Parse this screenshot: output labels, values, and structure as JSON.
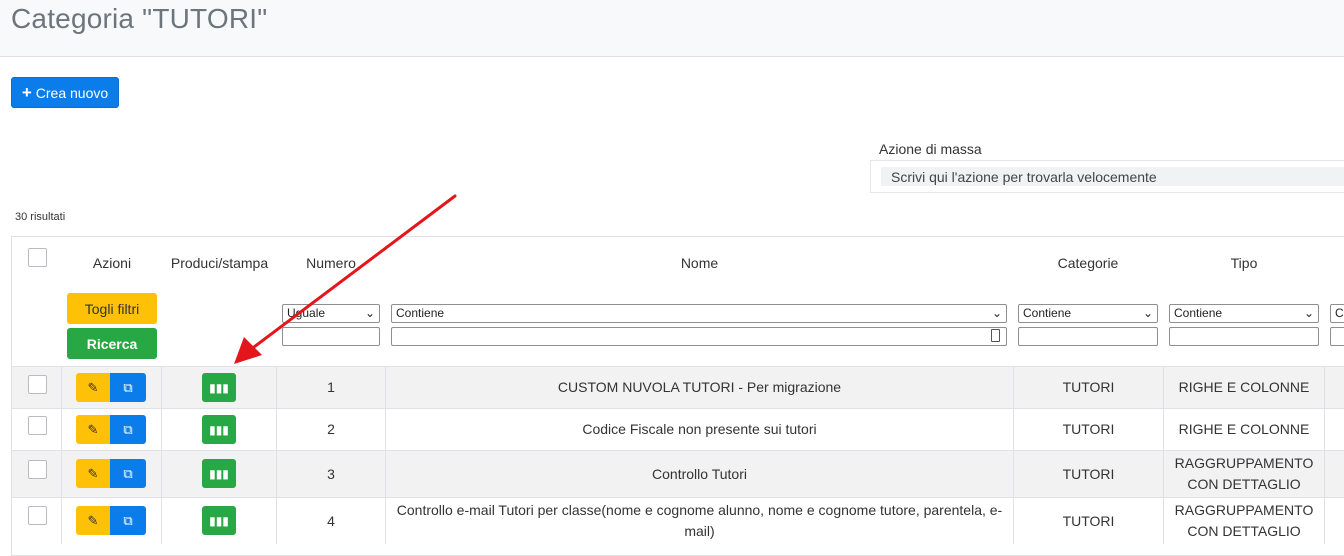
{
  "page": {
    "title": "Categoria \"TUTORI\""
  },
  "toolbar": {
    "create_label": "Crea nuovo"
  },
  "mass_action": {
    "label": "Azione di massa",
    "placeholder": "Scrivi qui l'azione per trovarla velocemente"
  },
  "results": {
    "count_text": "30 risultati"
  },
  "table": {
    "headers": {
      "actions": "Azioni",
      "print": "Produci/stampa",
      "number": "Numero",
      "name": "Nome",
      "categories": "Categorie",
      "type": "Tipo"
    },
    "filters": {
      "clear_label": "Togli filtri",
      "search_label": "Ricerca",
      "number_op": "Uguale",
      "name_op": "Contiene",
      "categories_op": "Contiene",
      "type_op": "Contiene",
      "extra_op": "Co"
    },
    "rows": [
      {
        "number": "1",
        "name": "CUSTOM NUVOLA TUTORI - Per migrazione",
        "category": "TUTORI",
        "type": "RIGHE E COLONNE"
      },
      {
        "number": "2",
        "name": "Codice Fiscale non presente sui tutori",
        "category": "TUTORI",
        "type": "RIGHE E COLONNE"
      },
      {
        "number": "3",
        "name": "Controllo Tutori",
        "category": "TUTORI",
        "type": "RAGGRUPPAMENTO CON DETTAGLIO"
      },
      {
        "number": "4",
        "name": "Controllo e-mail Tutori per classe(nome e cognome alunno, nome e cognome tutore, parentela, e-mail)",
        "category": "TUTORI",
        "type": "RAGGRUPPAMENTO CON DETTAGLIO"
      }
    ]
  },
  "colors": {
    "primary": "#0b7dea",
    "warning": "#ffc107",
    "success": "#28a745",
    "annotation_arrow": "#e3161c"
  }
}
